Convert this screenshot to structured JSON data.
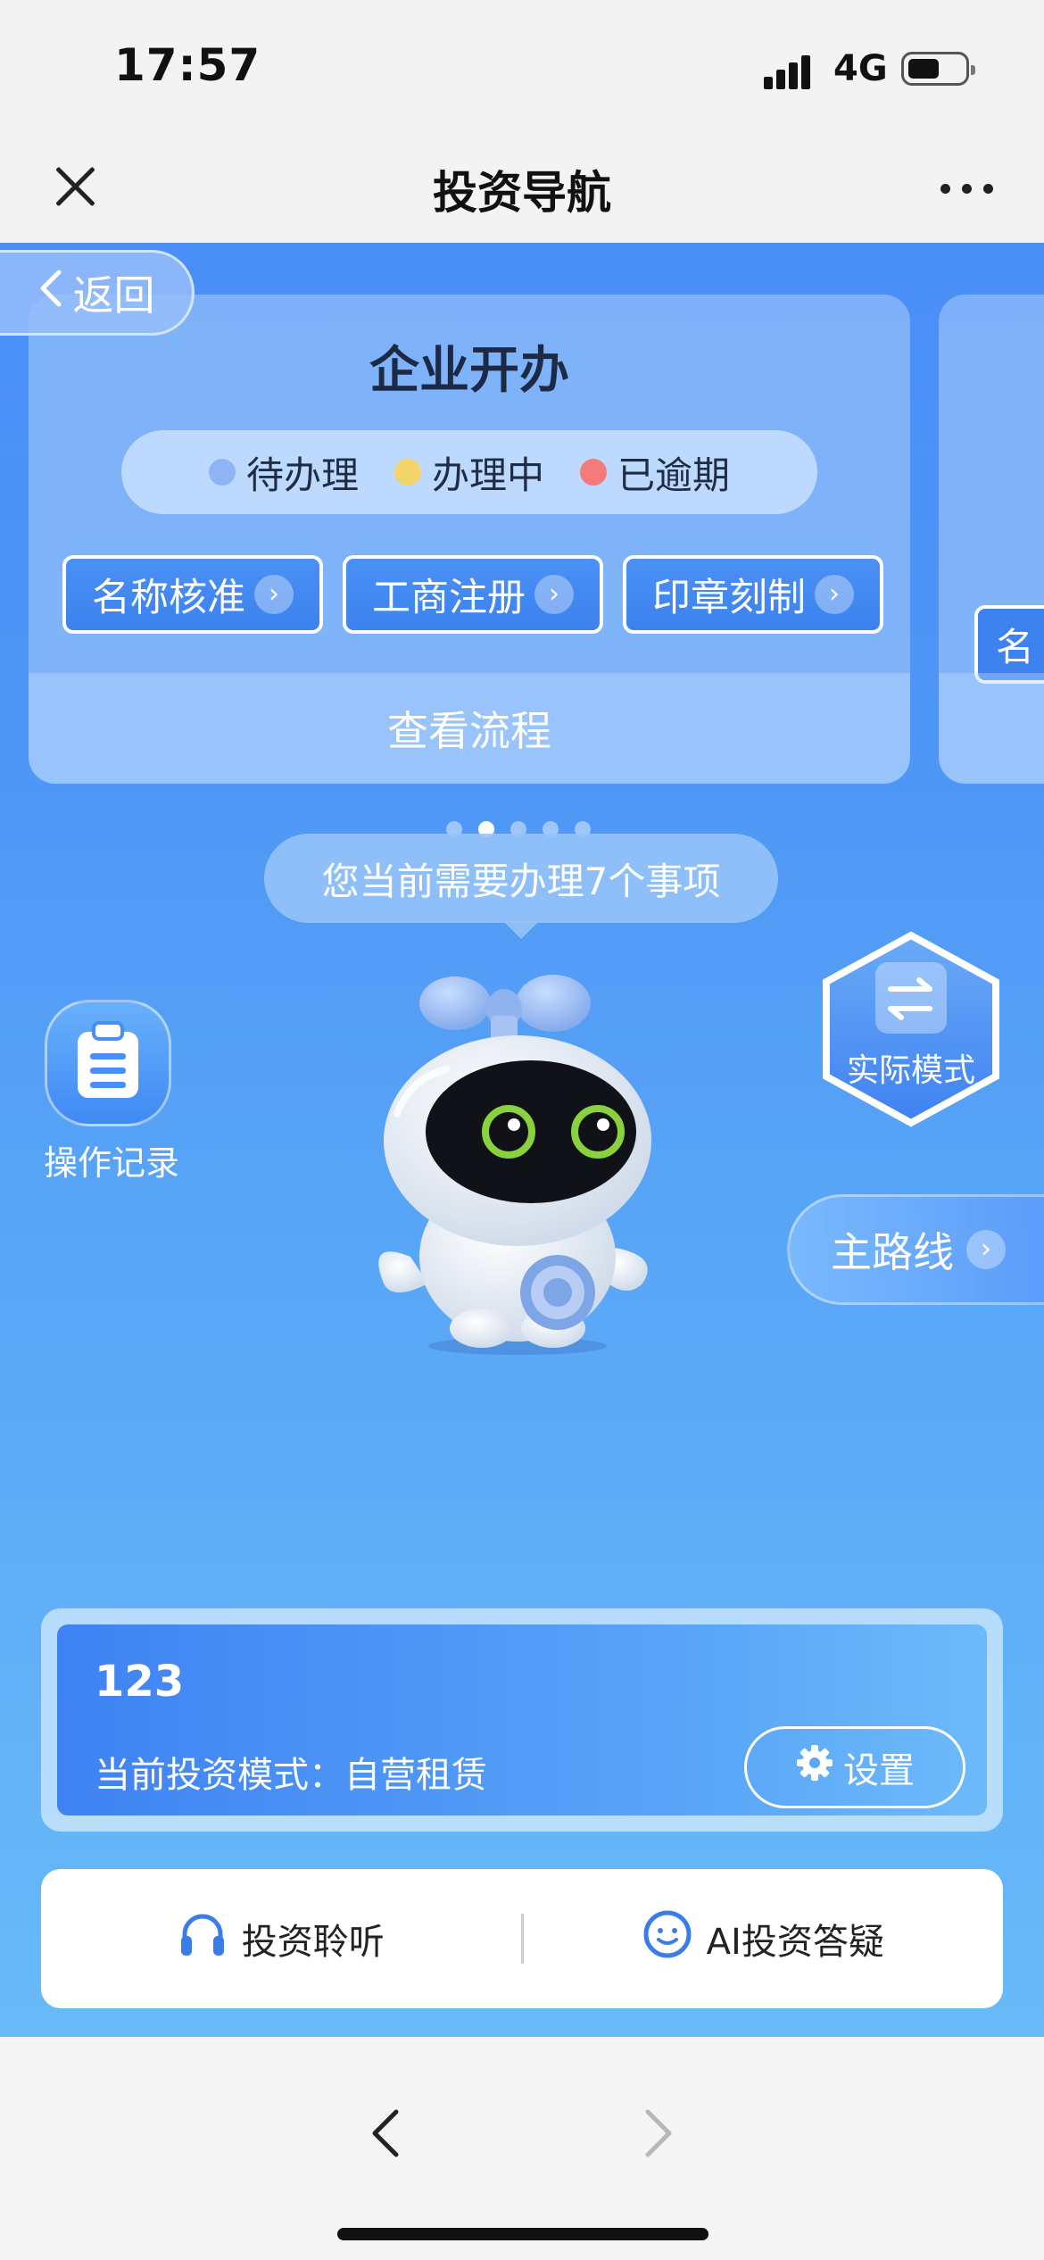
{
  "status_bar": {
    "time": "17:57",
    "network": "4G"
  },
  "nav": {
    "title": "投资导航"
  },
  "back": {
    "label": "返回"
  },
  "card": {
    "title": "企业开办",
    "legend": [
      {
        "label": "待办理",
        "color": "#8fb4f5"
      },
      {
        "label": "办理中",
        "color": "#f3d46a"
      },
      {
        "label": "已逾期",
        "color": "#f57a7a"
      }
    ],
    "steps": [
      "名称核准",
      "工商注册",
      "印章刻制"
    ],
    "footer": "查看流程",
    "next_card_partial_step": "名"
  },
  "pager": {
    "count": 5,
    "active": 1
  },
  "bubble": {
    "text": "您当前需要办理7个事项"
  },
  "record": {
    "label": "操作记录"
  },
  "mode_toggle": {
    "label": "实际模式"
  },
  "main_route": {
    "label": "主路线"
  },
  "info": {
    "name": "123",
    "mode_label": "当前投资模式：自营租赁",
    "settings_label": "设置"
  },
  "actions": {
    "listen": "投资聆听",
    "ai": "AI投资答疑"
  },
  "colors": {
    "primary_blue": "#4a8ef7",
    "dark_text": "#1d2a45"
  }
}
